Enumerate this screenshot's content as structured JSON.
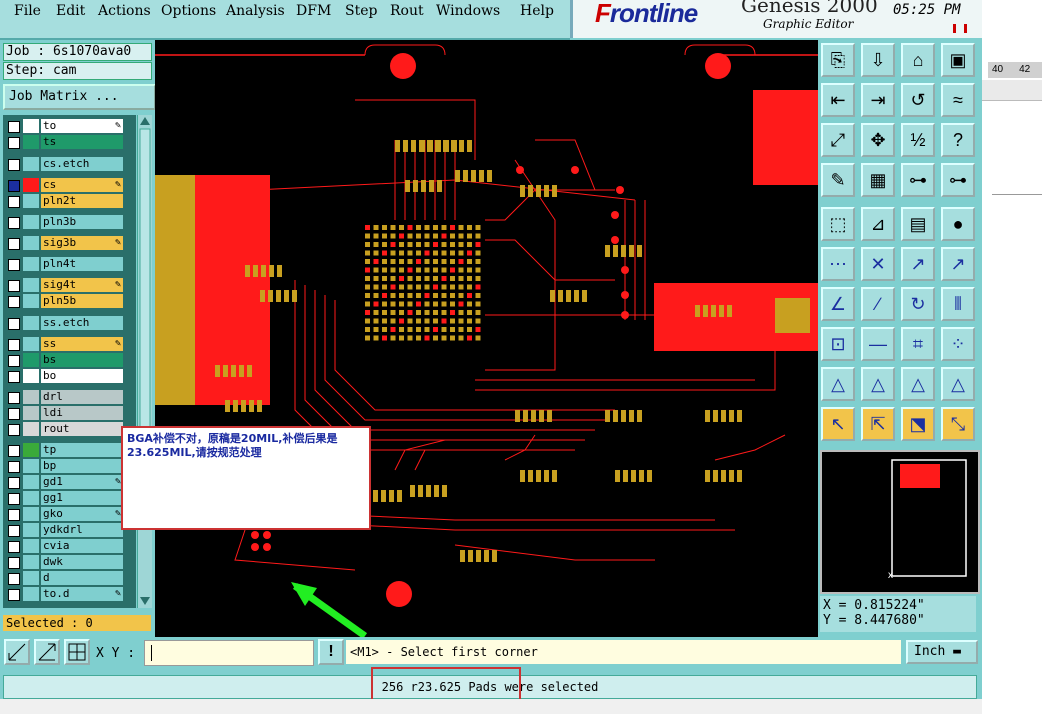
{
  "menubar": {
    "items": [
      "File",
      "Edit",
      "Actions",
      "Options",
      "Analysis",
      "DFM",
      "Step",
      "Rout",
      "Windows",
      "Help"
    ]
  },
  "logo": {
    "brand_f": "F",
    "brand_rest": "rontline",
    "product": "Genesis 2000",
    "subtitle": "Graphic Editor",
    "time": "05:25 PM"
  },
  "job": {
    "job_line": "Job : 6s1070ava0",
    "step_line": "Step: cam",
    "matrix_button": "Job Matrix ..."
  },
  "layers": [
    {
      "name": "to",
      "color": "#ffffff",
      "bg": "#ffffff",
      "checked": false,
      "mark": true
    },
    {
      "name": "ts",
      "color": "#1f9a6a",
      "bg": "#1f9a6a",
      "checked": false,
      "mark": false
    },
    {
      "name": "cs.etch",
      "color": "#7fcfcf",
      "bg": "#7fcfcf",
      "checked": false,
      "mark": false
    },
    {
      "name": "cs",
      "color": "#ff1a1a",
      "bg": "#f2c44a",
      "checked": true,
      "mark": true
    },
    {
      "name": "pln2t",
      "color": "#7fcfcf",
      "bg": "#f2c44a",
      "checked": false,
      "mark": false
    },
    {
      "name": "pln3b",
      "color": "#7fcfcf",
      "bg": "#7fcfcf",
      "checked": false,
      "mark": false
    },
    {
      "name": "sig3b",
      "color": "#7fcfcf",
      "bg": "#f2c44a",
      "checked": false,
      "mark": true
    },
    {
      "name": "pln4t",
      "color": "#7fcfcf",
      "bg": "#7fcfcf",
      "checked": false,
      "mark": false
    },
    {
      "name": "sig4t",
      "color": "#7fcfcf",
      "bg": "#f2c44a",
      "checked": false,
      "mark": true
    },
    {
      "name": "pln5b",
      "color": "#7fcfcf",
      "bg": "#f2c44a",
      "checked": false,
      "mark": false
    },
    {
      "name": "ss.etch",
      "color": "#7fcfcf",
      "bg": "#7fcfcf",
      "checked": false,
      "mark": false
    },
    {
      "name": "ss",
      "color": "#7fcfcf",
      "bg": "#f2c44a",
      "checked": false,
      "mark": true
    },
    {
      "name": "bs",
      "color": "#1f9a6a",
      "bg": "#1f9a6a",
      "checked": false,
      "mark": false
    },
    {
      "name": "bo",
      "color": "#ffffff",
      "bg": "#ffffff",
      "checked": false,
      "mark": false
    },
    {
      "name": "drl",
      "color": "#b8c8c8",
      "bg": "#b8c8c8",
      "checked": false,
      "mark": false
    },
    {
      "name": "ldi",
      "color": "#b8c8c8",
      "bg": "#b8c8c8",
      "checked": false,
      "mark": false
    },
    {
      "name": "rout",
      "color": "#d8d8d8",
      "bg": "#d8d8d8",
      "checked": false,
      "mark": false
    },
    {
      "name": "tp",
      "color": "#3aaa3a",
      "bg": "#7fcfcf",
      "checked": false,
      "mark": false
    },
    {
      "name": "bp",
      "color": "#7fcfcf",
      "bg": "#7fcfcf",
      "checked": false,
      "mark": false
    },
    {
      "name": "gd1",
      "color": "#7fcfcf",
      "bg": "#7fcfcf",
      "checked": false,
      "mark": true
    },
    {
      "name": "gg1",
      "color": "#7fcfcf",
      "bg": "#7fcfcf",
      "checked": false,
      "mark": false
    },
    {
      "name": "gko",
      "color": "#7fcfcf",
      "bg": "#7fcfcf",
      "checked": false,
      "mark": true
    },
    {
      "name": "ydkdrl",
      "color": "#7fcfcf",
      "bg": "#7fcfcf",
      "checked": false,
      "mark": false
    },
    {
      "name": "cvia",
      "color": "#7fcfcf",
      "bg": "#7fcfcf",
      "checked": false,
      "mark": false
    },
    {
      "name": "dwk",
      "color": "#7fcfcf",
      "bg": "#7fcfcf",
      "checked": false,
      "mark": false
    },
    {
      "name": "d",
      "color": "#7fcfcf",
      "bg": "#7fcfcf",
      "checked": false,
      "mark": false
    },
    {
      "name": "to.d",
      "color": "#7fcfcf",
      "bg": "#7fcfcf",
      "checked": false,
      "mark": true
    }
  ],
  "selected_label": "Selected : 0",
  "note": {
    "text": "BGA补偿不对，原稿是20MIL,补偿后果是23.625MIL,请按规范处理"
  },
  "tools": [
    "open-step",
    "save",
    "home",
    "layout",
    "snap-left",
    "snap-right",
    "undo-redo",
    "redraw",
    "zoom-fit",
    "zoom-pan",
    "scale-1-2",
    "help",
    "palette",
    "grid",
    "graphic-layer-a",
    "graphic-layer-b",
    "zoom-box",
    "line-cut",
    "ruler",
    "pad",
    "connect",
    "cross",
    "point-move",
    "point-add",
    "arc-add",
    "arc-cut",
    "rotate",
    "mirror",
    "pad-add",
    "line-add",
    "measure-box",
    "group",
    "shape-a",
    "shape-b",
    "shape-c",
    "shape-d",
    "select-arrow",
    "select-box",
    "select-poly",
    "select-route"
  ],
  "coords": {
    "x": "X = 0.815224\"",
    "y": "Y = 8.447680\""
  },
  "bottom": {
    "xy_label": "X Y :",
    "xy_value": "",
    "bang": "!",
    "prompt": "<M1> - Select first corner",
    "units": "Inch"
  },
  "status": {
    "message": "256 r23.625 Pads were selected"
  },
  "gutter": {
    "num1": "40",
    "num2": "42"
  },
  "colors": {
    "accent": "#7fcfcf",
    "highlight": "#f2c44a",
    "copper": "#ff1a1a",
    "pad": "#c8a020"
  }
}
